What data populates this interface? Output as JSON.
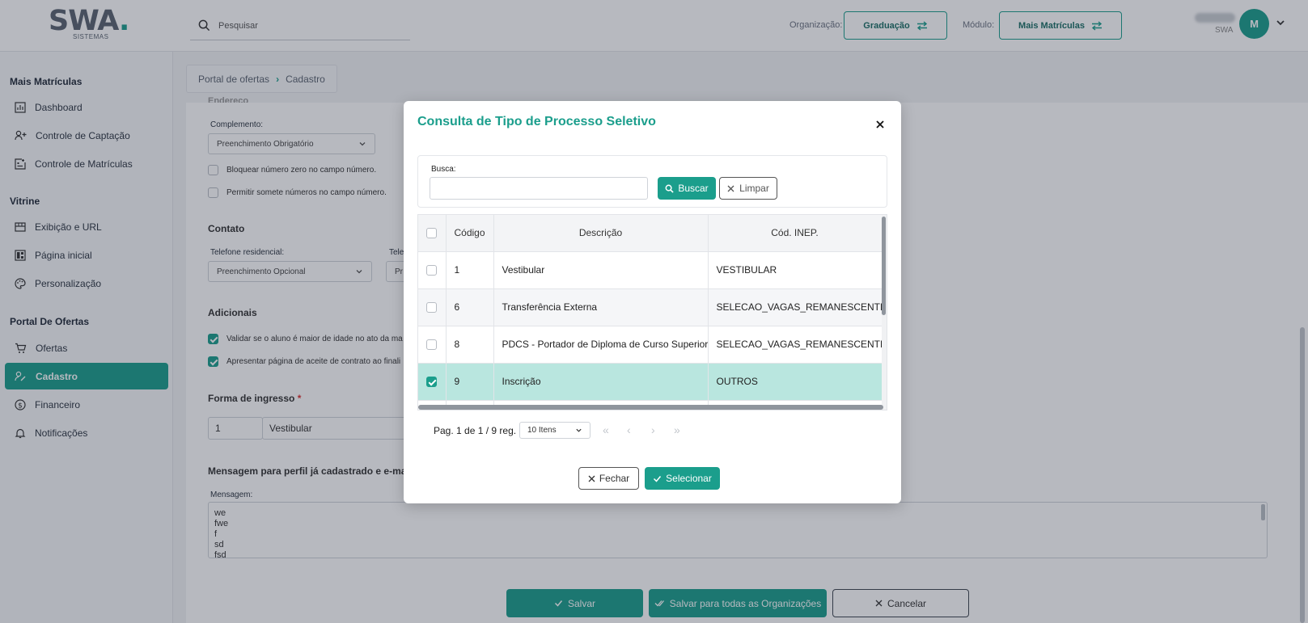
{
  "header": {
    "logo_text": "SWA.",
    "logo_sub": "SISTEMAS",
    "search_placeholder": "Pesquisar",
    "org_label": "Organização:",
    "org_value": "Graduação",
    "module_label": "Módulo:",
    "module_value": "Mais Matrículas",
    "user_tag": "SWA",
    "avatar_initial": "M"
  },
  "sidebar": {
    "sections": [
      {
        "title": "Mais Matrículas",
        "items": [
          {
            "label": "Dashboard",
            "icon": "dashboard-icon"
          },
          {
            "label": "Controle de Captação",
            "icon": "user-plus-icon"
          },
          {
            "label": "Controle de Matrículas",
            "icon": "enrollment-icon"
          }
        ]
      },
      {
        "title": "Vitrine",
        "items": [
          {
            "label": "Exibição e URL",
            "icon": "storefront-icon"
          },
          {
            "label": "Página inicial",
            "icon": "grid-icon"
          },
          {
            "label": "Personalização",
            "icon": "palette-icon"
          }
        ]
      },
      {
        "title": "Portal De Ofertas",
        "items": [
          {
            "label": "Ofertas",
            "icon": "cart-icon"
          },
          {
            "label": "Cadastro",
            "icon": "user-edit-icon",
            "active": true
          },
          {
            "label": "Financeiro",
            "icon": "dollar-icon"
          },
          {
            "label": "Notificações",
            "icon": "bell-icon"
          }
        ]
      }
    ]
  },
  "breadcrumb": {
    "parent": "Portal de ofertas",
    "current": "Cadastro"
  },
  "form": {
    "cut_heading": "Endereço",
    "complemento_label": "Complemento:",
    "complemento_value": "Preenchimento Obrigatório",
    "check_bloquear": "Bloquear número zero no campo número.",
    "check_permitir": "Permitir somete números no campo número.",
    "contato_heading": "Contato",
    "tel_res_label": "Telefone residencial:",
    "tel_res_value": "Preenchimento Opcional",
    "tel_label_cut": "Tele",
    "tel_value_cut": "Pr",
    "adicionais_heading": "Adicionais",
    "check_validar": "Validar se o aluno é maior de idade no ato da ma",
    "check_apresentar": "Apresentar página de aceite de contrato ao finali",
    "forma_heading": "Forma de ingresso",
    "forma_req": "*",
    "forma_code": "1",
    "forma_desc": "Vestibular",
    "mensagem_heading": "Mensagem para perfil já cadastrado e e-ma",
    "mensagem_label": "Mensagem:",
    "mensagem_lines": [
      "we",
      "fwe",
      "f",
      "sd",
      "fsd"
    ]
  },
  "footer_buttons": {
    "salvar": "Salvar",
    "salvar_todas": "Salvar para todas as Organizações",
    "cancelar": "Cancelar"
  },
  "modal": {
    "title": "Consulta de Tipo de Processo Seletivo",
    "search_label": "Busca:",
    "search_value": "",
    "buscar": "Buscar",
    "limpar": "Limpar",
    "columns": [
      "Código",
      "Descrição",
      "Cód. INEP."
    ],
    "rows": [
      {
        "codigo": "1",
        "descricao": "Vestibular",
        "inep": "VESTIBULAR",
        "checked": false
      },
      {
        "codigo": "6",
        "descricao": "Transferência Externa",
        "inep": "SELECAO_VAGAS_REMANESCENTES",
        "checked": false
      },
      {
        "codigo": "8",
        "descricao": "PDCS - Portador de Diploma de Curso Superior",
        "inep": "SELECAO_VAGAS_REMANESCENTES",
        "checked": false
      },
      {
        "codigo": "9",
        "descricao": "Inscrição",
        "inep": "OUTROS",
        "checked": true
      }
    ],
    "pager_text": "Pag. 1 de 1 / 9 reg.",
    "per_page": "10 Itens",
    "fechar": "Fechar",
    "selecionar": "Selecionar"
  },
  "colors": {
    "accent": "#1b9e8c",
    "selected_row": "#b9e6df",
    "overlay": "rgba(30,38,56,0.32)"
  }
}
